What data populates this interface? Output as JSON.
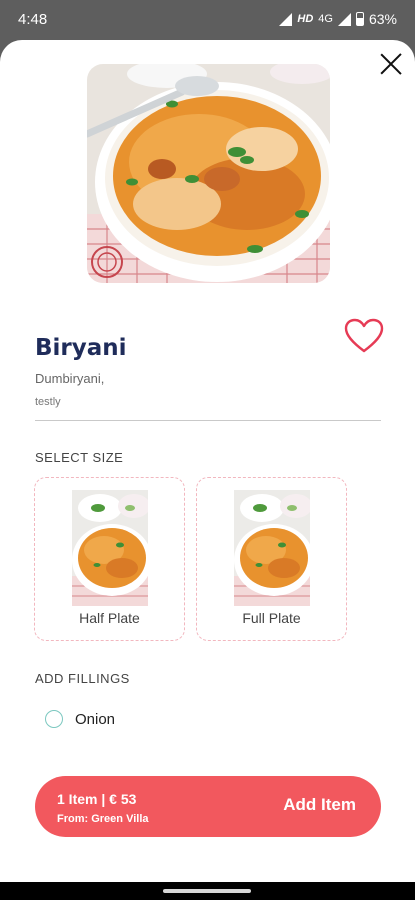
{
  "status_bar": {
    "time": "4:48",
    "hd": "HD",
    "network": "4G",
    "battery": "63%"
  },
  "icons": {
    "close": "close-icon",
    "favorite": "heart-outline-icon",
    "signal": "signal-icon",
    "battery": "battery-icon"
  },
  "item": {
    "name": "Biryani",
    "restaurant_tag": "Dumbiryani,",
    "description": "testly"
  },
  "sections": {
    "select_size": "SELECT SIZE",
    "add_fillings": "ADD FILLINGS"
  },
  "sizes": [
    {
      "label": "Half Plate"
    },
    {
      "label": "Full Plate"
    }
  ],
  "fillings": [
    {
      "label": "Onion",
      "selected": false
    }
  ],
  "cart_button": {
    "summary": "1 Item | € 53",
    "from": "From: Green Villa",
    "action": "Add Item"
  },
  "colors": {
    "accent": "#f2585e",
    "title": "#1f2c5a",
    "radio": "#7cc8c0",
    "card_border": "#f2b7bf"
  }
}
